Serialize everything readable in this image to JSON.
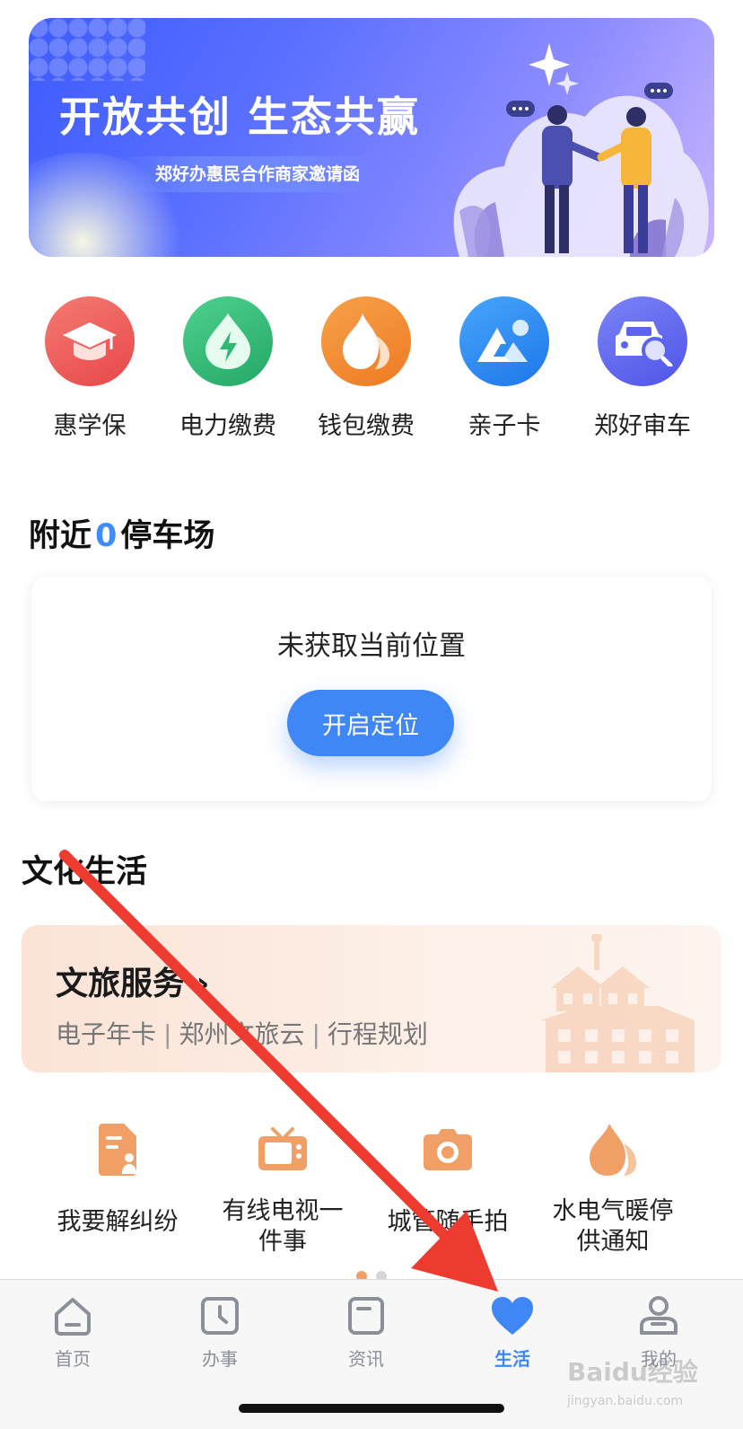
{
  "banner": {
    "title": "开放共创 生态共赢",
    "subtitle": "郑好办惠民合作商家邀请函"
  },
  "quick_services": [
    {
      "label": "惠学保",
      "icon": "graduation-cap-icon",
      "color": "#f05a5a"
    },
    {
      "label": "电力缴费",
      "icon": "power-drop-icon",
      "color": "#2fb874"
    },
    {
      "label": "钱包缴费",
      "icon": "flame-icon",
      "color": "#f28a2e"
    },
    {
      "label": "亲子卡",
      "icon": "mountain-icon",
      "color": "#2f8df5"
    },
    {
      "label": "郑好审车",
      "icon": "car-search-icon",
      "color": "#5b63f0"
    }
  ],
  "parking": {
    "title_prefix": "附近",
    "count": "0",
    "title_suffix": "停车场",
    "message": "未获取当前位置",
    "button": "开启定位"
  },
  "culture": {
    "section_title": "文化生活",
    "card_title": "文旅服务",
    "card_chevron": "›",
    "links": [
      "电子年卡",
      "郑州文旅云",
      "行程规划"
    ],
    "separator": "|",
    "services": [
      {
        "label": "我要解纠纷",
        "icon": "document-person-icon"
      },
      {
        "label": "有线电视一件事",
        "icon": "tv-icon"
      },
      {
        "label": "城管随手拍",
        "icon": "camera-icon"
      },
      {
        "label": "水电气暖停供通知",
        "icon": "flame-icon"
      }
    ],
    "accent_color": "#f0a066"
  },
  "pager": {
    "pages": 2,
    "active_index": 0,
    "active_color": "#f0a066",
    "inactive_color": "#d6d6d6"
  },
  "tabbar": {
    "tabs": [
      {
        "label": "首页",
        "icon": "home-icon",
        "active": false
      },
      {
        "label": "办事",
        "icon": "clock-icon",
        "active": false
      },
      {
        "label": "资讯",
        "icon": "news-icon",
        "active": false
      },
      {
        "label": "生活",
        "icon": "heart-icon",
        "active": true
      },
      {
        "label": "我的",
        "icon": "person-icon",
        "active": false
      }
    ],
    "active_color": "#3f86f7",
    "inactive_color": "#8a8f99"
  },
  "watermark": {
    "text": "Baidu经验",
    "sub": "jingyan.baidu.com"
  }
}
